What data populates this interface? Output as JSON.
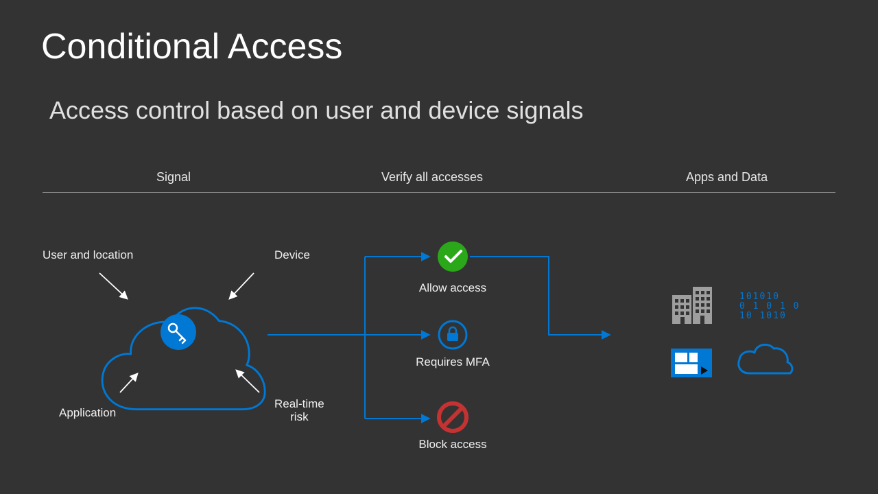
{
  "title": "Conditional Access",
  "subtitle": "Access control based on user and device signals",
  "columns": {
    "signal": "Signal",
    "verify": "Verify all accesses",
    "apps": "Apps and Data"
  },
  "signals": {
    "user_location": "User and location",
    "device": "Device",
    "application": "Application",
    "real_time_risk": "Real-time\nrisk"
  },
  "verify": {
    "allow": "Allow access",
    "mfa": "Requires MFA",
    "block": "Block access"
  },
  "colors": {
    "accent_blue": "#0078d4",
    "green": "#2ba81a",
    "red": "#c53232",
    "gray_icon": "#9e9e9e"
  },
  "icons": {
    "cloud_key": "cloud-key-icon",
    "check": "check-circle-icon",
    "lock": "lock-circle-icon",
    "block": "block-circle-icon",
    "building": "building-icon",
    "binary": "binary-icon",
    "tile": "windows-tile-icon",
    "cloud_small": "cloud-icon"
  },
  "binary_text": "101010\n0 1 0 1 0\n10 1010"
}
